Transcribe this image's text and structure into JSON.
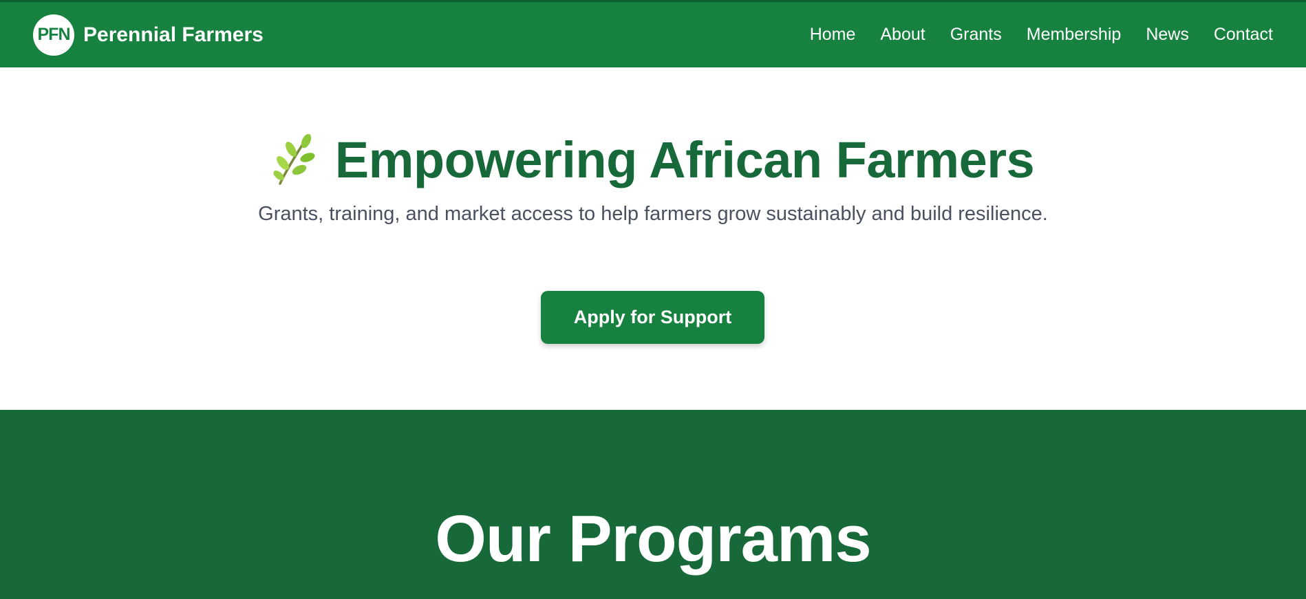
{
  "brand": {
    "logo_text": "PFN",
    "name": "Perennial Farmers"
  },
  "nav": {
    "links": [
      "Home",
      "About",
      "Grants",
      "Membership",
      "News",
      "Contact"
    ]
  },
  "hero": {
    "icon": "herb-leaf-icon",
    "title": "Empowering African Farmers",
    "subtitle": "Grants, training, and market access to help farmers grow sustainably and build resilience.",
    "cta_label": "Apply for Support"
  },
  "programs": {
    "title": "Our Programs"
  },
  "colors": {
    "primary_green": "#178140",
    "dark_green": "#18693a",
    "subtitle_gray": "#4a5060",
    "white": "#ffffff"
  }
}
